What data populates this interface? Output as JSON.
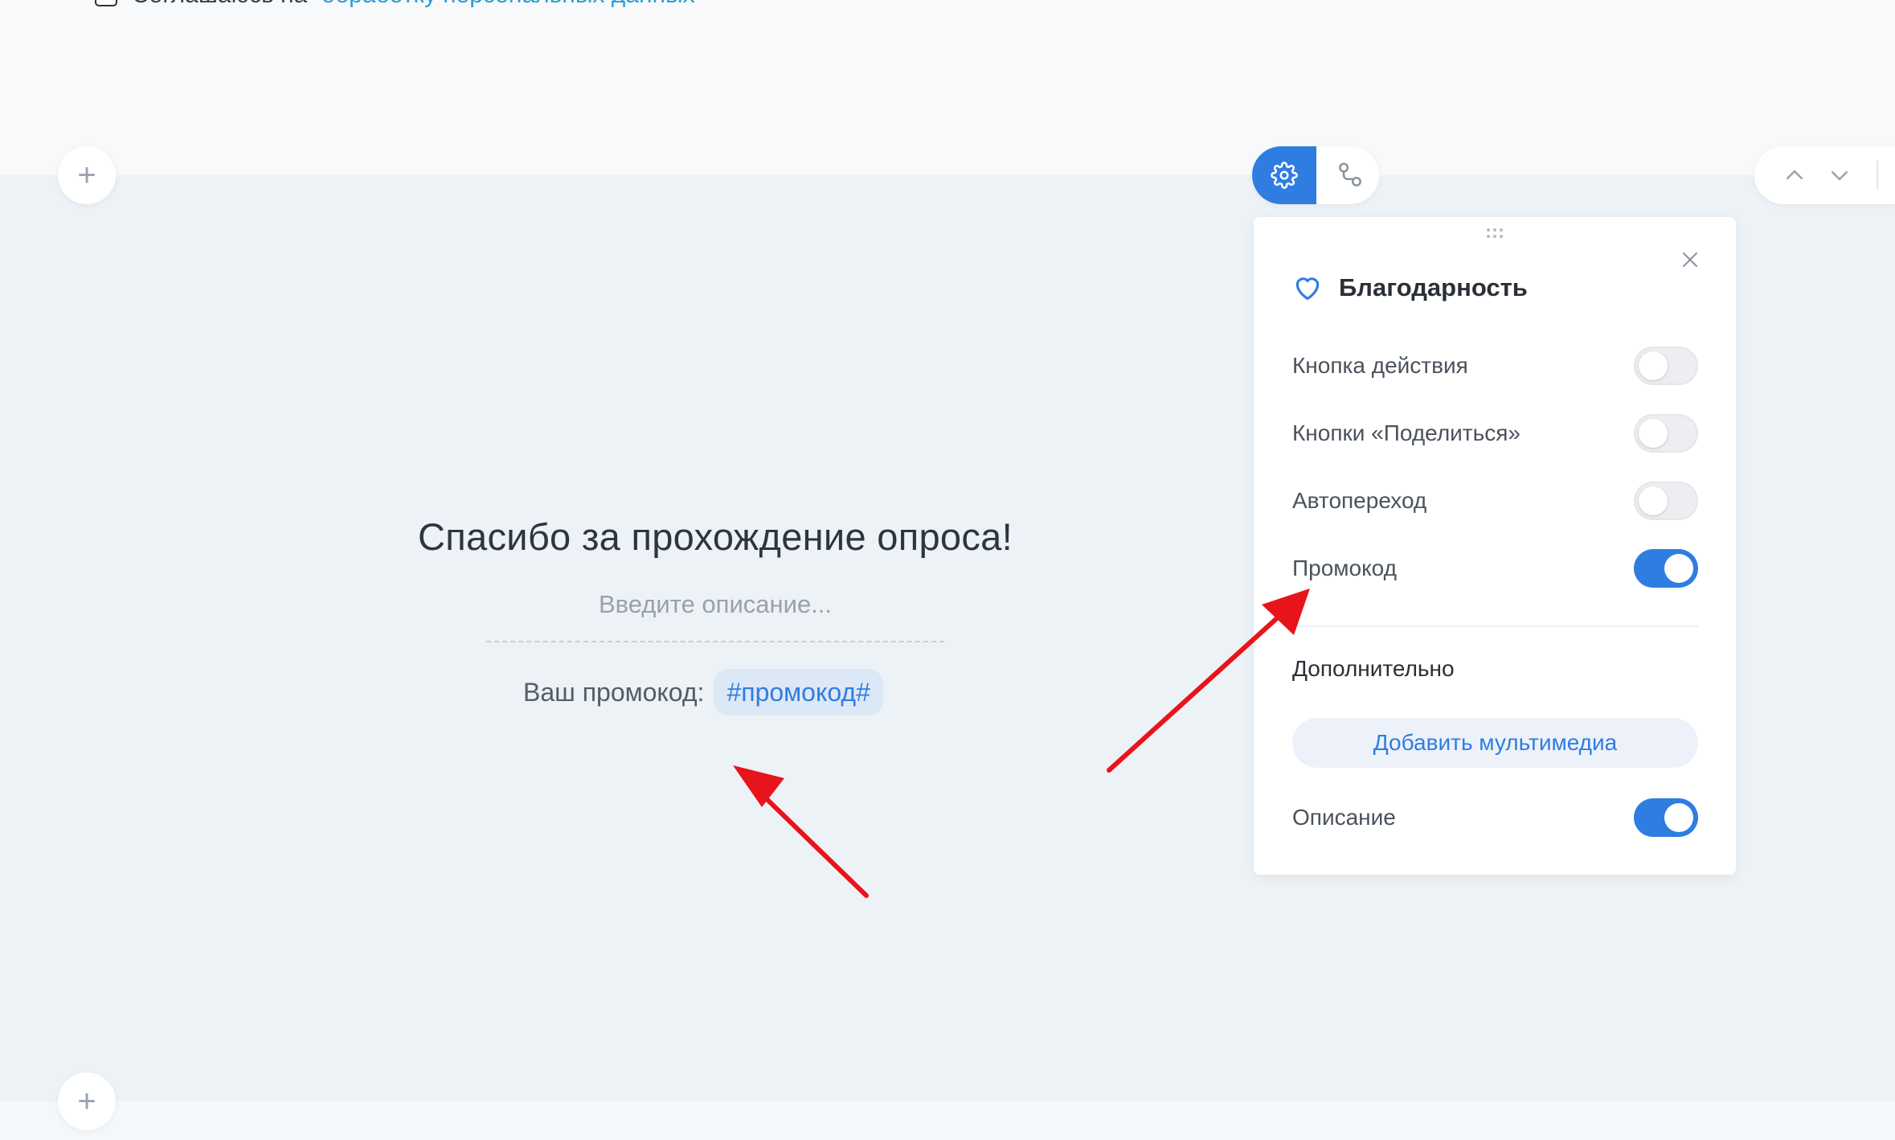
{
  "consent": {
    "prefix": "Соглашаюсь на",
    "link": "обработку персональных данных"
  },
  "icons": {
    "add": "plus-icon",
    "settings": "gear-icon",
    "logic": "branch-logic-icon",
    "up": "chevron-up-icon",
    "down": "chevron-down-icon",
    "heart": "heart-icon",
    "close": "close-icon",
    "drag": "drag-handle-icon"
  },
  "add_block_symbol": "+",
  "thanks": {
    "title": "Спасибо за прохождение опроса!",
    "description_placeholder": "Введите описание...",
    "promo_label": "Ваш промокод:",
    "promo_tag": "#промокод#"
  },
  "panel": {
    "title": "Благодарность",
    "toggles": [
      {
        "label": "Кнопка действия",
        "on": false
      },
      {
        "label": "Кнопки «Поделиться»",
        "on": false
      },
      {
        "label": "Автопереход",
        "on": false
      },
      {
        "label": "Промокод",
        "on": true
      }
    ],
    "extra_section": "Дополнительно",
    "add_media_button": "Добавить мультимедиа",
    "description_toggle": {
      "label": "Описание",
      "on": true
    }
  },
  "colors": {
    "accent": "#2f7de1",
    "annotation_arrow": "#e8141b",
    "link": "#2a9cd8"
  }
}
